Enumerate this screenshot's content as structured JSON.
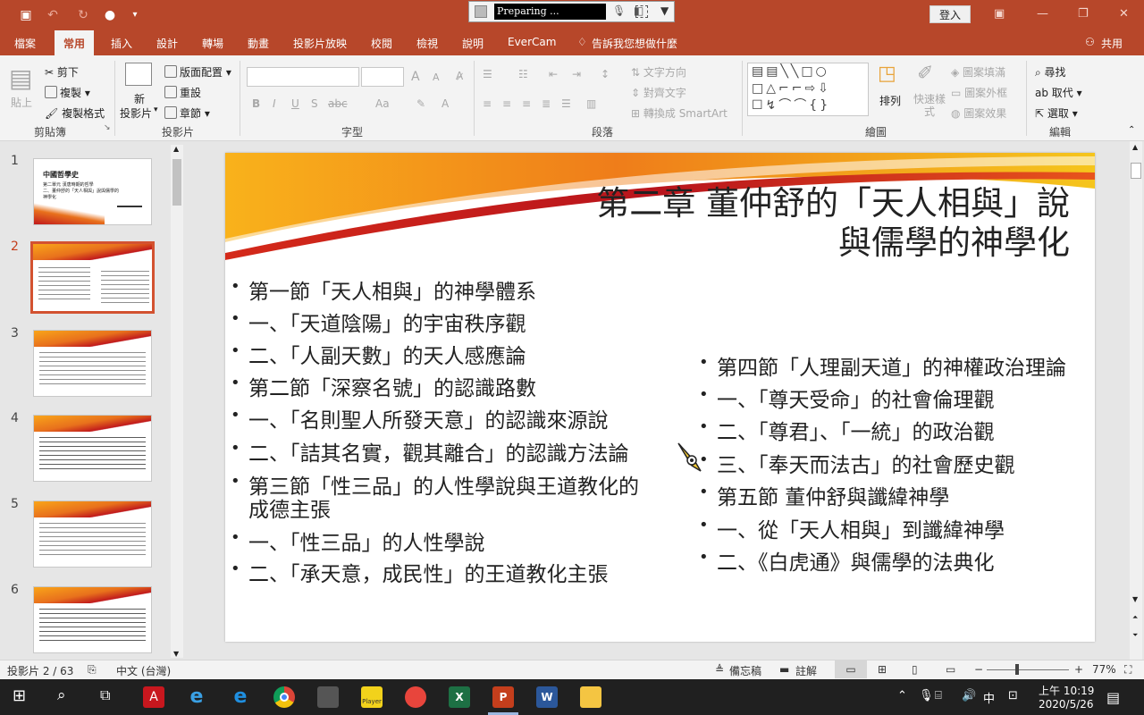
{
  "titlebar": {
    "recorder_status": "Preparing ...",
    "sign_in": "登入"
  },
  "tabs": [
    {
      "label": "檔案"
    },
    {
      "label": "常用"
    },
    {
      "label": "插入"
    },
    {
      "label": "設計"
    },
    {
      "label": "轉場"
    },
    {
      "label": "動畫"
    },
    {
      "label": "投影片放映"
    },
    {
      "label": "校閱"
    },
    {
      "label": "檢視"
    },
    {
      "label": "說明"
    },
    {
      "label": "EverCam"
    }
  ],
  "tell_me": "告訴我您想做什麼",
  "share": "共用",
  "ribbon": {
    "clipboard": {
      "paste": "貼上",
      "cut": "剪下",
      "copy": "複製",
      "format_painter": "複製格式",
      "group": "剪貼簿"
    },
    "slides": {
      "new_slide": "新",
      "new_slide2": "投影片",
      "layout": "版面配置",
      "reset": "重設",
      "section": "章節",
      "group": "投影片"
    },
    "font": {
      "group": "字型",
      "b": "B",
      "i": "I",
      "u": "U",
      "s": "S",
      "abc": "abc",
      "aa": "Aa",
      "a_up": "A",
      "a_down": "A"
    },
    "paragraph": {
      "text_direction": "文字方向",
      "align_text": "對齊文字",
      "smartart": "轉換成 SmartArt",
      "group": "段落"
    },
    "drawing": {
      "arrange": "排列",
      "quick_styles": "快速樣式",
      "fill": "圖案填滿",
      "outline": "圖案外框",
      "effects": "圖案效果",
      "group": "繪圖"
    },
    "editing": {
      "find": "尋找",
      "replace": "取代",
      "select": "選取",
      "group": "編輯"
    }
  },
  "thumbnails": [
    {
      "num": "1"
    },
    {
      "num": "2"
    },
    {
      "num": "3"
    },
    {
      "num": "4"
    },
    {
      "num": "5"
    },
    {
      "num": "6"
    }
  ],
  "thumb1": {
    "line1": "中國哲學史",
    "line2": "第二單元 漢唐時期的哲學",
    "line3": "二、董仲舒的「天人相與」說與儒學的",
    "line4": "神學化"
  },
  "slide": {
    "title_line1": "第二章 董仲舒的「天人相與」說",
    "title_line2": "與儒學的神學化",
    "left": [
      "第一節「天人相與」的神學體系",
      "一、「天道陰陽」的宇宙秩序觀",
      "二、「人副天數」的天人感應論",
      "第二節「深察名號」的認識路數",
      "一、「名則聖人所發天意」的認識來源說",
      "二、「詰其名實，觀其離合」的認識方法論",
      "第三節「性三品」的人性學說與王道教化的",
      "成德主張",
      "一、「性三品」的人性學說",
      "二、「承天意，成民性」的王道教化主張"
    ],
    "right": [
      "第四節「人理副天道」的神權政治理論",
      "一、「尊天受命」的社會倫理觀",
      "二、「尊君」、「一統」的政治觀",
      "三、「奉天而法古」的社會歷史觀",
      "第五節 董仲舒與讖緯神學",
      "一、從「天人相與」到讖緯神學",
      "二、《白虎通》與儒學的法典化"
    ]
  },
  "status": {
    "slide_pos": "投影片 2 / 63",
    "lang": "中文 (台灣)",
    "notes": "備忘稿",
    "comments": "註解",
    "zoom": "77%"
  },
  "taskbar": {
    "ime": "中",
    "time": "上午 10:19",
    "date": "2020/5/26",
    "player": "Player"
  }
}
